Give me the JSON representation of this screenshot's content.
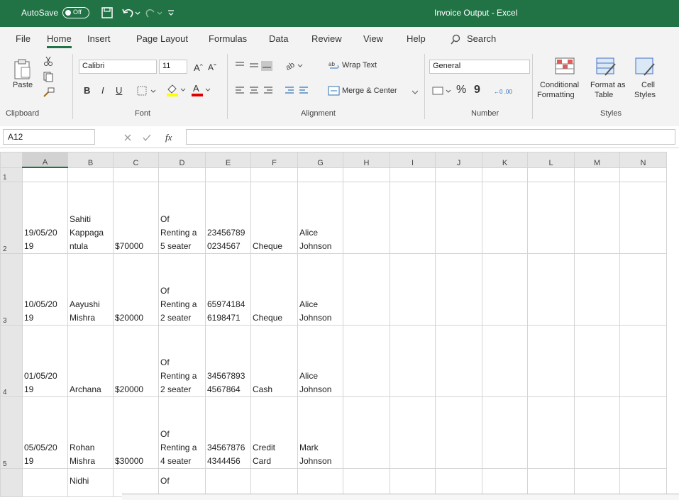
{
  "titlebar": {
    "autosave_label": "AutoSave",
    "autosave_state": "Off",
    "document_title": "Invoice Output  -  Excel"
  },
  "menu": {
    "items": [
      "File",
      "Home",
      "Insert",
      "Page Layout",
      "Formulas",
      "Data",
      "Review",
      "View",
      "Help"
    ],
    "search_label": "Search"
  },
  "ribbon": {
    "clipboard": {
      "paste_label": "Paste",
      "group_label": "Clipboard"
    },
    "font": {
      "font_name": "Calibri",
      "font_size": "11",
      "bold": "B",
      "italic": "I",
      "underline": "U",
      "grow": "Aˆ",
      "shrink": "Aˇ",
      "group_label": "Font"
    },
    "alignment": {
      "wrap_text": "Wrap Text",
      "merge_center": "Merge & Center",
      "group_label": "Alignment"
    },
    "number": {
      "format": "General",
      "percent": "%",
      "comma": "9",
      "group_label": "Number"
    },
    "styles": {
      "conditional_line1": "Conditional",
      "conditional_line2": "Formatting",
      "format_table_line1": "Format as",
      "format_table_line2": "Table",
      "cell_styles_line1": "Cell",
      "cell_styles_line2": "Styles",
      "group_label": "Styles"
    }
  },
  "formula_bar": {
    "name_box": "A12",
    "fx_label": "fx",
    "value": ""
  },
  "sheet": {
    "columns": [
      "A",
      "B",
      "C",
      "D",
      "E",
      "F",
      "G",
      "H",
      "I",
      "J",
      "K",
      "L",
      "M",
      "N"
    ],
    "rows": [
      {
        "num": "1",
        "cells": [
          "",
          "",
          "",
          "",
          "",
          "",
          ""
        ]
      },
      {
        "num": "2",
        "cells": [
          "19/05/20\n19",
          "Sahiti\nKappaga\nntula",
          "$70000",
          "Of\nRenting a\n5 seater",
          "23456789\n0234567",
          "Cheque",
          "Alice\nJohnson"
        ]
      },
      {
        "num": "3",
        "cells": [
          "10/05/20\n19",
          "Aayushi\nMishra",
          "$20000",
          "Of\nRenting a\n2 seater",
          "65974184\n6198471",
          "Cheque",
          "Alice\nJohnson"
        ]
      },
      {
        "num": "4",
        "cells": [
          "01/05/20\n19",
          "Archana",
          "$20000",
          "Of\nRenting a\n2 seater",
          "34567893\n4567864",
          "Cash",
          "Alice\nJohnson"
        ]
      },
      {
        "num": "5",
        "cells": [
          "05/05/20\n19",
          "Rohan\nMishra",
          "$30000",
          "Of\nRenting a\n4 seater",
          "34567876\n4344456",
          "Credit\nCard",
          "Mark\nJohnson"
        ]
      },
      {
        "num": "",
        "cells": [
          "",
          "Nidhi",
          "",
          "Of",
          "",
          "",
          ""
        ]
      }
    ]
  },
  "colors": {
    "excel_green": "#217346",
    "ribbon_bg": "#f3f3f3"
  }
}
